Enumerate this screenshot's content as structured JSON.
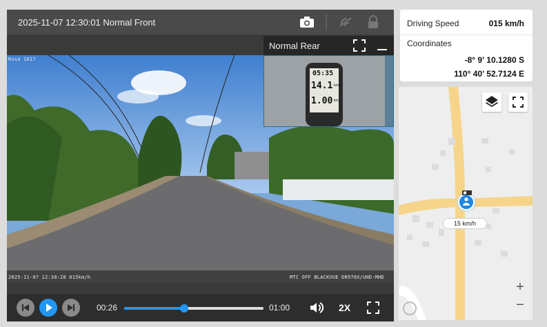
{
  "player": {
    "title": "2025-11-07 12:30:01 Normal Front",
    "pip_title": "Normal Rear",
    "osd_top_left": "Rusa 1617",
    "osd_timestamp": "2025-11-07 12:30:28 015km/h",
    "osd_bottom_right": "MTC OFF BLACKVUE DR970X/UHD-MHD",
    "pip_gauge": {
      "time": "05:35",
      "speed": "14.1",
      "distance": "1.00",
      "unit_speed": "km/h",
      "unit_dist": "km"
    },
    "controls": {
      "current_time": "00:26",
      "total_time": "01:00",
      "progress": 0.43,
      "speed": "2X"
    },
    "icons": [
      "camera-icon",
      "no-signal-icon",
      "lock-icon",
      "expand-icon",
      "minimize-icon",
      "prev-icon",
      "play-icon",
      "next-icon",
      "volume-icon",
      "fullscreen-icon"
    ]
  },
  "info": {
    "speed_label": "Driving Speed",
    "speed_value": "015 km/h",
    "coord_label": "Coordinates",
    "lat": "-8° 9' 10.1280 S",
    "lon": "110° 40' 52.7124 E"
  },
  "map": {
    "speed_tag": "15 km/h",
    "zoom_in": "+",
    "zoom_out": "−",
    "colors": {
      "road": "#f6d58a",
      "building": "#dcdcde",
      "marker": "#1e88e5"
    }
  }
}
